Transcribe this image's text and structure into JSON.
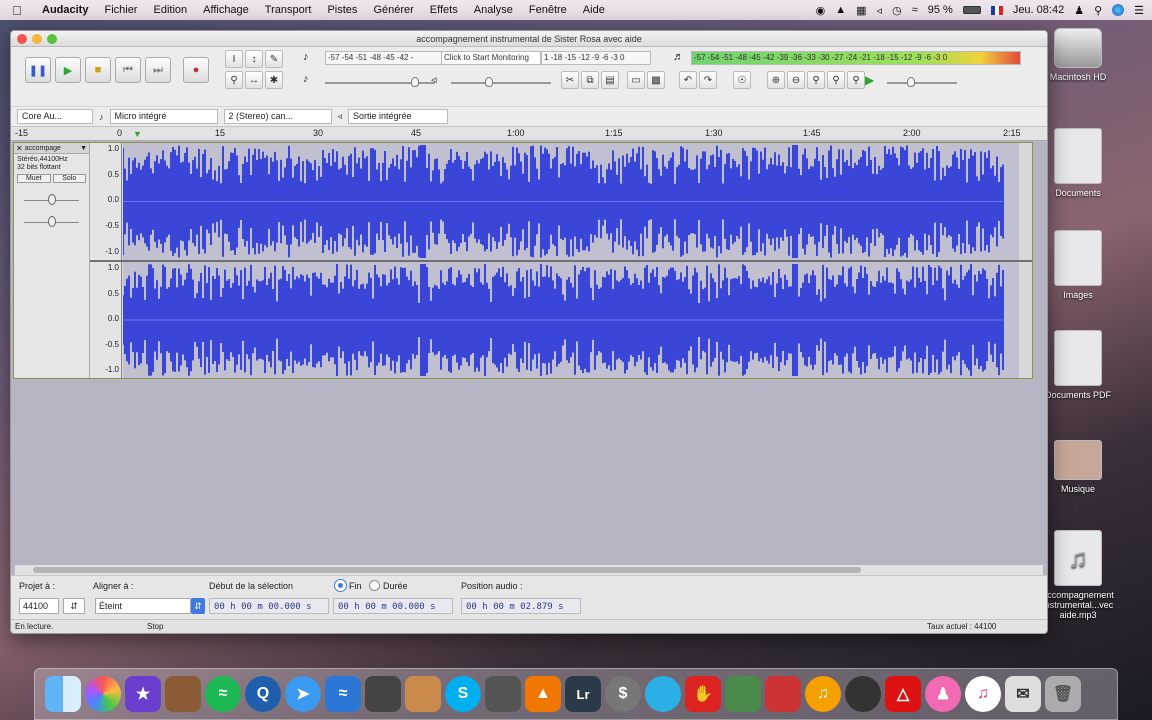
{
  "menubar": {
    "app_name": "Audacity",
    "items": [
      "Fichier",
      "Edition",
      "Affichage",
      "Transport",
      "Pistes",
      "Générer",
      "Effets",
      "Analyse",
      "Fenêtre",
      "Aide"
    ],
    "battery": "95 %",
    "clock": "Jeu. 08:42"
  },
  "desktop": {
    "items": [
      {
        "label": "Macintosh HD"
      },
      {
        "label": "Documents"
      },
      {
        "label": "Images"
      },
      {
        "label": "Documents PDF"
      },
      {
        "label": "Musique"
      },
      {
        "label": "accompagnement instrumental...vec aide.mp3"
      }
    ]
  },
  "window": {
    "title": "accompagnement instrumental de Sister Rosa avec aide"
  },
  "toolbar": {
    "rec_meter_scale": "-57 -54 -51 -48 -45 -42 -",
    "monitor_label": "Click to Start Monitoring",
    "rec_meter_scale_right": "1 -18 -15 -12 -9 -6 -3 0",
    "play_meter_scale": "-57 -54 -51 -48 -45 -42 -39 -36 -33 -30 -27 -24 -21 -18 -15 -12 -9 -6 -3 0",
    "host": "Core Au...",
    "recording_device": "Micro intégré",
    "channels": "2 (Stereo) can...",
    "playback_device": "Sortie intégrée"
  },
  "timeline": {
    "labels": [
      "-15",
      "0",
      "15",
      "30",
      "45",
      "1:00",
      "1:15",
      "1:30",
      "1:45",
      "2:00",
      "2:15"
    ]
  },
  "track": {
    "name": "accompage",
    "info_line1": "Stéréo,44100Hz",
    "info_line2": "32 bits flottant",
    "mute_label": "Muet",
    "solo_label": "Solo",
    "scale_top": [
      "1.0",
      "0.5",
      "0.0",
      "-0.5",
      "-1.0"
    ],
    "scale_bottom": [
      "1.0",
      "0.5",
      "0.0",
      "-0.5",
      "-1.0"
    ]
  },
  "bottom": {
    "project_label": "Projet à :",
    "project_rate": "44100",
    "snap_label": "Aligner à :",
    "snap_value": "Éteint",
    "selection_label": "Début de la sélection",
    "radio_end": "Fin",
    "radio_length": "Durée",
    "selection_start": "00 h 00 m 00.000 s",
    "selection_end": "00 h 00 m 00.000 s",
    "audio_position_label": "Position audio :",
    "audio_position": "00 h 00 m 02.879 s"
  },
  "status": {
    "left": "En lecture.",
    "middle": "Stop",
    "right": "Taux actuel : 44100"
  },
  "colors": {
    "waveform": "#3a46d8",
    "waveform_bg": "#c0c0d0",
    "track_area": "#b5b5c4"
  },
  "dock": {
    "icons": [
      "finder-icon",
      "photos-icon",
      "imovie-icon",
      "dictionary-icon",
      "spotify-icon",
      "quicktime-icon",
      "safari-icon",
      "xcode-icon",
      "printer-icon",
      "preview-icon",
      "skype-icon",
      "disk-utility-icon",
      "vlc-icon",
      "lightroom-icon",
      "dollar-icon",
      "globe-icon",
      "stop-icon",
      "monitor-icon",
      "facetime-icon",
      "audacity-icon",
      "speedometer-icon",
      "acrobat-icon",
      "itunes-person-icon",
      "itunes-icon",
      "mail-icon",
      "trash-icon"
    ]
  }
}
